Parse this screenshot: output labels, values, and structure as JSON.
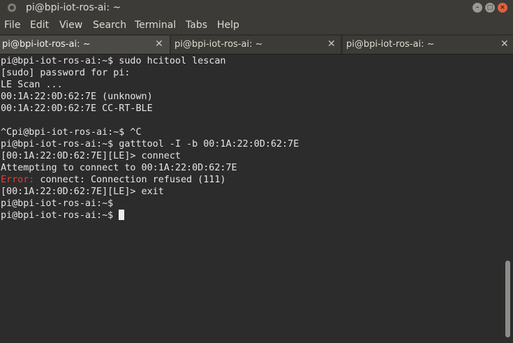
{
  "window": {
    "title": "pi@bpi-iot-ros-ai: ~"
  },
  "menu": [
    "File",
    "Edit",
    "View",
    "Search",
    "Terminal",
    "Tabs",
    "Help"
  ],
  "tabs": [
    {
      "label": "pi@bpi-iot-ros-ai: ~",
      "active": true
    },
    {
      "label": "pi@bpi-iot-ros-ai: ~",
      "active": false
    },
    {
      "label": "pi@bpi-iot-ros-ai: ~",
      "active": false
    }
  ],
  "terminal": {
    "lines": [
      "pi@bpi-iot-ros-ai:~$ sudo hcitool lescan",
      "[sudo] password for pi:",
      "LE Scan ...",
      "00:1A:22:0D:62:7E (unknown)",
      "00:1A:22:0D:62:7E CC-RT-BLE",
      "",
      "^Cpi@bpi-iot-ros-ai:~$ ^C",
      "pi@bpi-iot-ros-ai:~$ gatttool -I -b 00:1A:22:0D:62:7E",
      "[00:1A:22:0D:62:7E][LE]> connect",
      "Attempting to connect to 00:1A:22:0D:62:7E",
      "",
      "[00:1A:22:0D:62:7E][LE]> exit",
      "pi@bpi-iot-ros-ai:~$",
      "pi@bpi-iot-ros-ai:~$"
    ],
    "error_prefix": "Error:",
    "error_message": " connect: Connection refused (111)"
  },
  "colors": {
    "error": "#e63b3b",
    "close_button": "#e0613e",
    "background": "#2c2c2c"
  }
}
